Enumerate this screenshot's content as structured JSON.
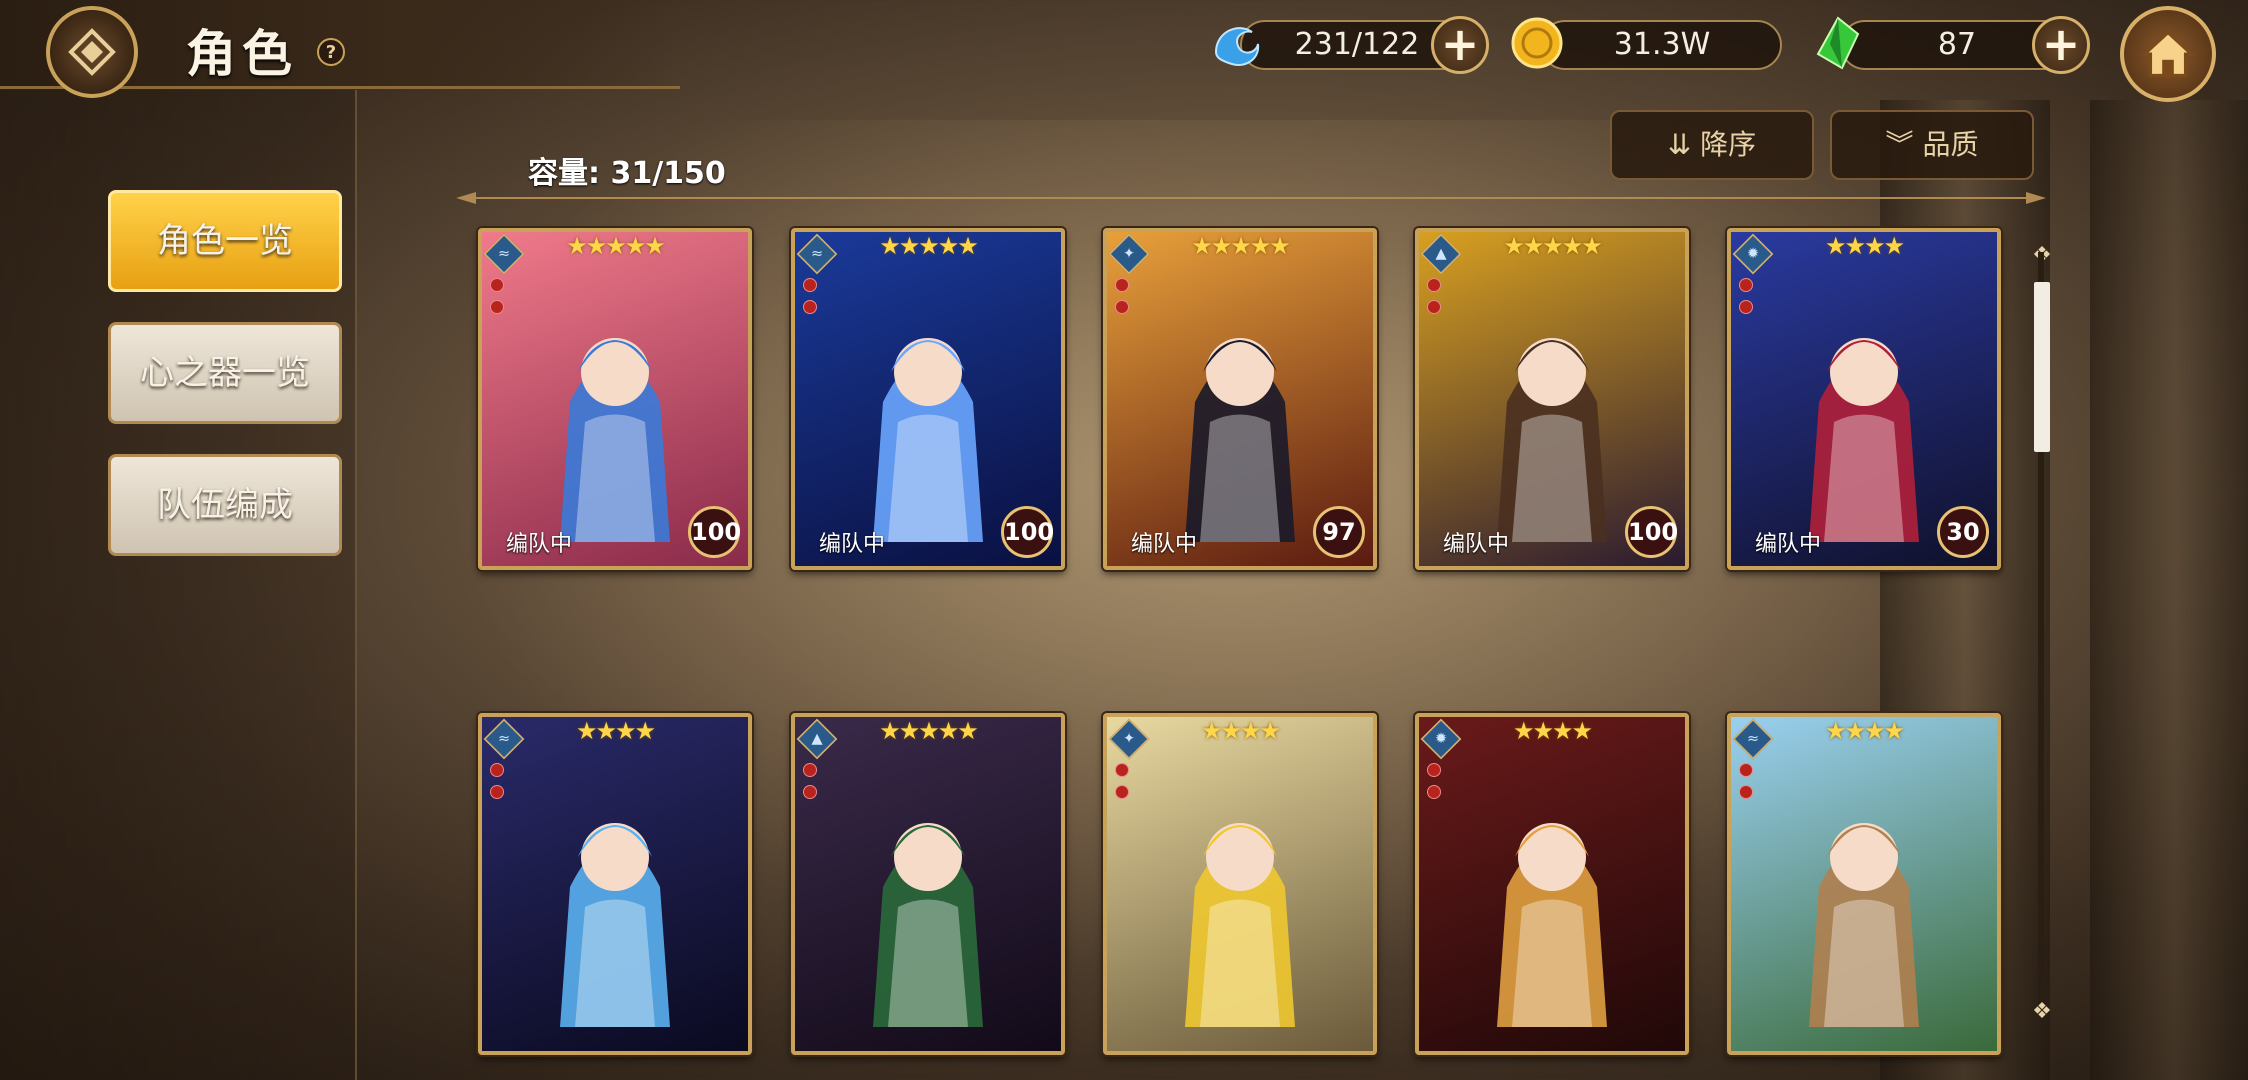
{
  "header": {
    "title": "角色",
    "help": "?"
  },
  "resources": [
    {
      "icon": "stamina-icon",
      "value": "231/122"
    },
    {
      "icon": "gold-coin-icon",
      "value": "31.3W"
    },
    {
      "icon": "green-crystal-icon",
      "value": "87"
    }
  ],
  "sidebar": {
    "items": [
      {
        "label": "角色一览",
        "active": true
      },
      {
        "label": "心之器一览",
        "active": false
      },
      {
        "label": "队伍编成",
        "active": false
      }
    ]
  },
  "capacity": "容量: 31/150",
  "sort": {
    "order_label": "降序",
    "filter_label": "品质"
  },
  "cards": [
    {
      "stars": "★★★★★",
      "team": "编队中",
      "level": "100",
      "elem": "water",
      "bg": [
        "#f07a8a",
        "#8a2a4a"
      ],
      "hair": "#3a7ad8"
    },
    {
      "stars": "★★★★★",
      "team": "编队中",
      "level": "100",
      "elem": "water",
      "bg": [
        "#1a3a9a",
        "#0a1040"
      ],
      "hair": "#6aa6ff"
    },
    {
      "stars": "★★★★★",
      "team": "编队中",
      "level": "97",
      "elem": "wind",
      "bg": [
        "#e8a03a",
        "#5a1a10"
      ],
      "hair": "#1a1a2a"
    },
    {
      "stars": "★★★★★",
      "team": "编队中",
      "level": "100",
      "elem": "earth",
      "bg": [
        "#d8a020",
        "#2a1a30"
      ],
      "hair": "#4a3020"
    },
    {
      "stars": "★★★★",
      "team": "编队中",
      "level": "30",
      "elem": "light",
      "bg": [
        "#2a3aa0",
        "#10102a"
      ],
      "hair": "#b0203a"
    },
    {
      "stars": "★★★★",
      "team": "",
      "level": "",
      "elem": "water",
      "bg": [
        "#2a2a6a",
        "#0a0a20"
      ],
      "hair": "#5ab0f0"
    },
    {
      "stars": "★★★★★",
      "team": "",
      "level": "",
      "elem": "earth",
      "bg": [
        "#3a2a4a",
        "#120a18"
      ],
      "hair": "#2a6a3a"
    },
    {
      "stars": "★★★★",
      "team": "",
      "level": "",
      "elem": "wind",
      "bg": [
        "#e8d8a0",
        "#6a5a3a"
      ],
      "hair": "#f0c830"
    },
    {
      "stars": "★★★★",
      "team": "",
      "level": "",
      "elem": "light",
      "bg": [
        "#6a1a1a",
        "#200808"
      ],
      "hair": "#e0a040"
    },
    {
      "stars": "★★★★",
      "team": "",
      "level": "",
      "elem": "water",
      "bg": [
        "#9ad0f0",
        "#3a6a3a"
      ],
      "hair": "#b08050"
    }
  ]
}
